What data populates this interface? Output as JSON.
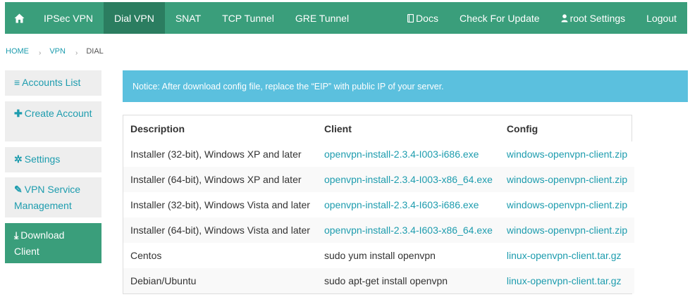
{
  "navbar": {
    "home_icon": "home-icon",
    "items": [
      {
        "label": "IPSec VPN",
        "active": false
      },
      {
        "label": "Dial VPN",
        "active": true
      },
      {
        "label": "SNAT",
        "active": false
      },
      {
        "label": "TCP Tunnel",
        "active": false
      },
      {
        "label": "GRE Tunnel",
        "active": false
      }
    ],
    "docs_label": "Docs",
    "docs_icon": "book-icon",
    "update_label": "Check For Update",
    "settings_label": "root Settings",
    "user_icon": "user-icon",
    "logout_label": "Logout"
  },
  "breadcrumb": {
    "home": "HOME",
    "vpn": "VPN",
    "current": "DIAL",
    "separator": "›"
  },
  "sidebar": {
    "items": [
      {
        "label": "Accounts List",
        "icon": "list-icon",
        "glyph": "≡",
        "active": false
      },
      {
        "label": "Create Account",
        "icon": "plus-icon",
        "glyph": "✚",
        "active": false
      },
      {
        "label": "Settings",
        "icon": "gear-icon",
        "glyph": "✲",
        "active": false
      },
      {
        "label": "VPN Service Management",
        "icon": "wrench-icon",
        "glyph": "✎",
        "active": false
      },
      {
        "label": "Download Client",
        "icon": "download-icon",
        "glyph": "⤓",
        "active": true
      }
    ]
  },
  "notice": {
    "text": "Notice: After download config file, replace the “EIP” with public IP of your server."
  },
  "table": {
    "headers": {
      "description": "Description",
      "client": "Client",
      "config": "Config"
    },
    "rows": [
      {
        "description": "Installer (32-bit), Windows XP and later",
        "client": "openvpn-install-2.3.4-I003-i686.exe",
        "client_is_link": true,
        "config": "windows-openvpn-client.zip"
      },
      {
        "description": "Installer (64-bit), Windows XP and later",
        "client": "openvpn-install-2.3.4-I003-x86_64.exe",
        "client_is_link": true,
        "config": "windows-openvpn-client.zip"
      },
      {
        "description": "Installer (32-bit), Windows Vista and later",
        "client": "openvpn-install-2.3.4-I603-i686.exe",
        "client_is_link": true,
        "config": "windows-openvpn-client.zip"
      },
      {
        "description": "Installer (64-bit), Windows Vista and later",
        "client": "openvpn-install-2.3.4-I603-x86_64.exe",
        "client_is_link": true,
        "config": "windows-openvpn-client.zip"
      },
      {
        "description": "Centos",
        "client": "sudo yum install openvpn",
        "client_is_link": false,
        "config": "linux-openvpn-client.tar.gz"
      },
      {
        "description": "Debian/Ubuntu",
        "client": "sudo apt-get install openvpn",
        "client_is_link": false,
        "config": "linux-openvpn-client.tar.gz"
      }
    ]
  },
  "colors": {
    "navbar": "#3a9e7b",
    "navbar_active": "#2b7d60",
    "link": "#1d9cae",
    "notice": "#5bc0de",
    "sidebar_bg": "#eeeeee"
  }
}
